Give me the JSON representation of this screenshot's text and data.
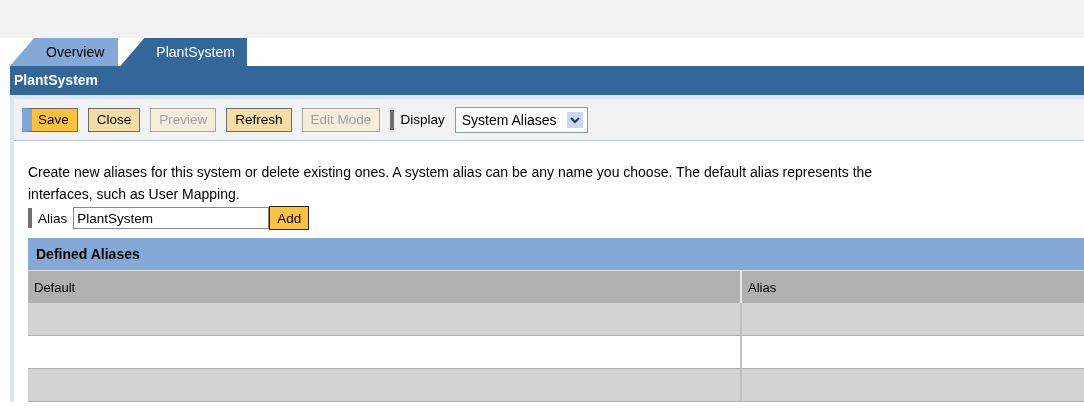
{
  "tabs": [
    {
      "label": "Overview",
      "selected": false
    },
    {
      "label": "PlantSystem",
      "selected": true
    }
  ],
  "title": "PlantSystem",
  "toolbar": {
    "buttons": [
      {
        "label": "Save",
        "kind": "primary",
        "disabled": false
      },
      {
        "label": "Close",
        "kind": "normal",
        "disabled": false
      },
      {
        "label": "Preview",
        "kind": "normal",
        "disabled": true
      },
      {
        "label": "Refresh",
        "kind": "normal",
        "disabled": false
      },
      {
        "label": "Edit Mode",
        "kind": "normal",
        "disabled": true
      }
    ],
    "display_label": "Display",
    "display_value": "System Aliases"
  },
  "description": [
    "Create new aliases for this system or delete existing ones. A system alias can be any name you choose. The default alias represents the",
    "interfaces, such as User Mapping."
  ],
  "alias_field": {
    "label": "Alias",
    "value": "PlantSystem",
    "button": "Add"
  },
  "table": {
    "title": "Defined Aliases",
    "columns": [
      "Default",
      "Alias"
    ]
  }
}
